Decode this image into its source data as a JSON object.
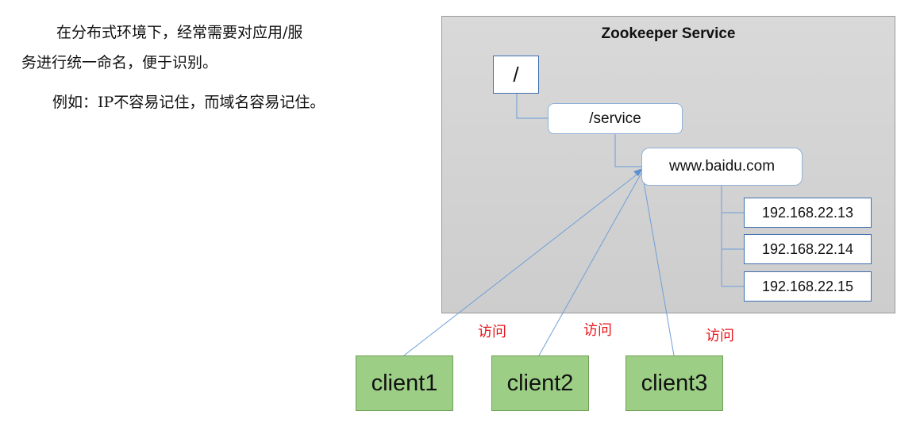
{
  "intro": {
    "line1": "在分布式环境下，经常需要对应用/服",
    "line2": "务进行统一命名，便于识别。",
    "line3_prefix": "例如：",
    "line3_ip": "IP",
    "line3_rest": "不容易记住，而域名容易记住。"
  },
  "diagram": {
    "title": "Zookeeper Service",
    "root": "/",
    "service": "/service",
    "domain": "www.baidu.com",
    "ips": [
      "192.168.22.13",
      "192.168.22.14",
      "192.168.22.15"
    ],
    "visit_labels": [
      "访问",
      "访问",
      "访问"
    ],
    "clients": [
      "client1",
      "client2",
      "client3"
    ]
  },
  "colors": {
    "service_bg": "#d9d9d9",
    "tree_border": "#3f6fb0",
    "link_line": "#6f9fd8",
    "client_fill": "#9ccf85",
    "visit_text": "#e8141b"
  }
}
